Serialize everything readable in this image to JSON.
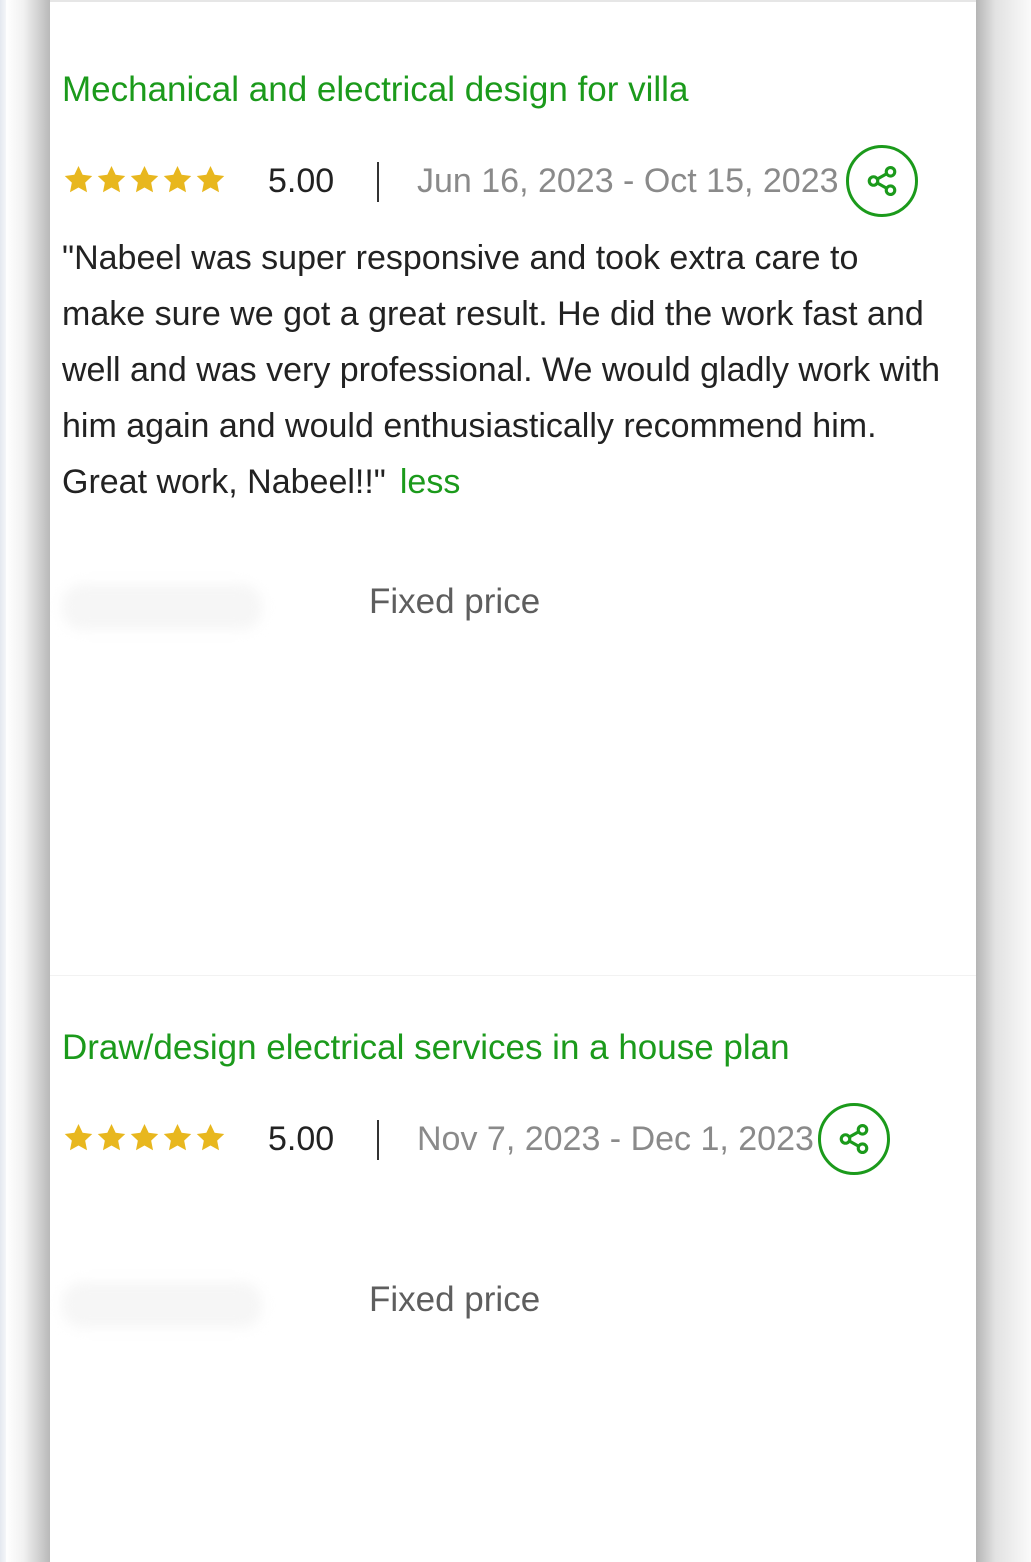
{
  "colors": {
    "accent": "#1b9a1b",
    "star": "#e8b71e",
    "text": "#222222",
    "muted": "#8a8a8a"
  },
  "reviews": [
    {
      "title": "Mechanical and electrical design for villa",
      "rating": 5.0,
      "rating_label": "5.00",
      "stars_filled": 5,
      "dates": "Jun 16, 2023 - Oct 15, 2023",
      "feedback": "\"Nabeel was super responsive and took extra care to make sure we got a great result. He did the work fast and well and was very professional. We would gladly work with him again and would enthusiastically recommend him. Great work, Nabeel!!\"",
      "less_label": "less",
      "price_type": "Fixed price",
      "share_icon": "share-icon"
    },
    {
      "title": "Draw/design electrical services in a house plan",
      "rating": 5.0,
      "rating_label": "5.00",
      "stars_filled": 5,
      "dates": "Nov 7, 2023 - Dec 1, 2023",
      "price_type": "Fixed price",
      "share_icon": "share-icon"
    }
  ]
}
